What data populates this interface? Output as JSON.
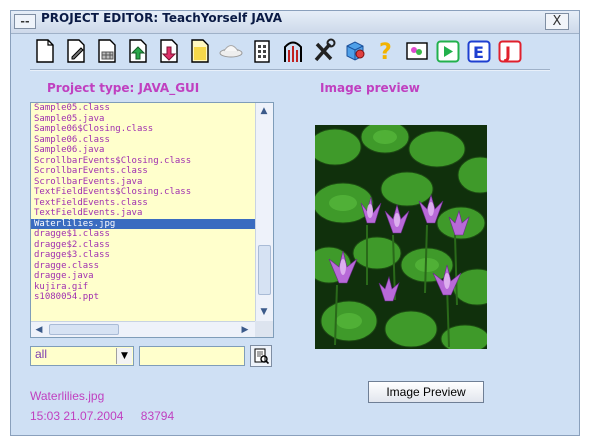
{
  "window": {
    "title": "PROJECT EDITOR: TeachYorself JAVA",
    "system_menu_label": "--",
    "close_label": "X"
  },
  "toolbar": {
    "buttons": [
      {
        "icon": "new-file-icon"
      },
      {
        "icon": "edit-file-icon"
      },
      {
        "icon": "file-grid-icon"
      },
      {
        "icon": "import-file-icon"
      },
      {
        "icon": "export-file-icon"
      },
      {
        "icon": "page-icon"
      },
      {
        "icon": "ufo-icon"
      },
      {
        "icon": "building-icon"
      },
      {
        "icon": "gate-icon"
      },
      {
        "icon": "tools-icon"
      },
      {
        "icon": "cube-icon"
      },
      {
        "icon": "help-icon"
      },
      {
        "icon": "preview-image-icon"
      },
      {
        "icon": "run-icon",
        "color": "#22b14c"
      },
      {
        "icon": "edit-e-icon",
        "label": "E",
        "color": "#1e3fd0"
      },
      {
        "icon": "java-j-icon",
        "label": "J",
        "color": "#e0202c"
      }
    ]
  },
  "project_type_label": "Project type: JAVA_GUI",
  "preview_label": "Image preview",
  "file_list": {
    "items": [
      "Sample05.class",
      "Sample05.java",
      "Sample06$Closing.class",
      "Sample06.class",
      "Sample06.java",
      "ScrollbarEvents$Closing.class",
      "ScrollbarEvents.class",
      "ScrollbarEvents.java",
      "TextFieldEvents$Closing.class",
      "TextFieldEvents.class",
      "TextFieldEvents.java",
      "Waterlilies.jpg",
      "dragge$1.class",
      "dragge$2.class",
      "dragge$3.class",
      "dragge.class",
      "dragge.java",
      "kujira.gif",
      "s1080054.ppt"
    ],
    "selected": "Waterlilies.jpg"
  },
  "filter": {
    "type_value": "all",
    "pattern_value": ""
  },
  "file_info": {
    "name": "Waterlilies.jpg",
    "time": "15:03 21.07.2004",
    "size": "83794"
  },
  "preview_button_label": "Image Preview",
  "colors": {
    "window_bg": "#cfe0f4",
    "label": "#c040c0",
    "list_bg": "#ffffcc",
    "selection": "#3a6cc0"
  }
}
